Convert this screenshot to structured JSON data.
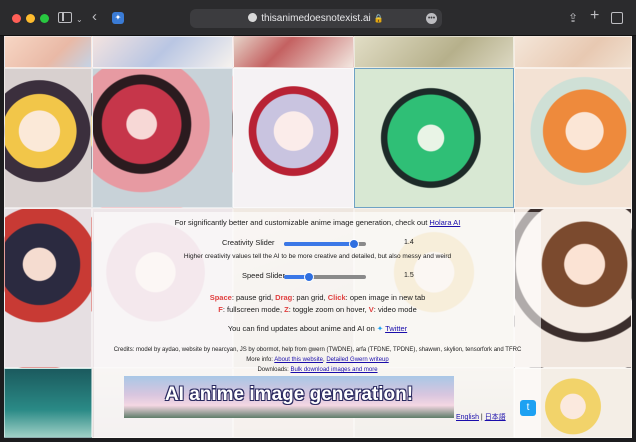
{
  "browser": {
    "url": "thisanimedoesnotexist.ai",
    "back_glyph": "‹",
    "chevron_glyph": "⌄",
    "share_glyph": "⇪",
    "new_tab_glyph": "+",
    "more_glyph": "•••",
    "lock_glyph": "🔒"
  },
  "promo": {
    "text": "For significantly better and customizable anime image generation, check out ",
    "link": "Holara AI"
  },
  "creativity": {
    "label": "Creativity Slider",
    "value": "1.4",
    "fraction": 0.85,
    "description": "Higher creativity values tell the AI to be more creative and detailed, but also messy and weird"
  },
  "speed": {
    "label": "Speed Slider",
    "value": "1.5",
    "fraction": 0.3
  },
  "shortcuts": {
    "line1": [
      {
        "key": "Space",
        "action": ": pause grid, "
      },
      {
        "key": "Drag",
        "action": ": pan grid, "
      },
      {
        "key": "Click",
        "action": ": open image in new tab"
      }
    ],
    "line2": [
      {
        "key": "F",
        "action": ": fullscreen mode, "
      },
      {
        "key": "Z",
        "action": ": toggle zoom on hover, "
      },
      {
        "key": "V",
        "action": ": video mode"
      }
    ]
  },
  "updates": {
    "text": "You can find updates about anime and AI on ",
    "link": "Twitter"
  },
  "credits": {
    "line1": "Credits: model by aydao, website by nearcyan, JS by obormot, help from gwern (TWDNE), arfa (TFDNE, TPDNE), shawwn, skylion, tensorfork and TFRC",
    "line2_label": "More info: ",
    "line2_links": [
      "About this website",
      "Detailed Gwern writeup"
    ],
    "line3_label": "Downloads: ",
    "line3_link": "Bulk download images and more"
  },
  "banner": {
    "text": "AI anime image generation!"
  },
  "language": {
    "english": "English",
    "separator": " | ",
    "japanese": "日本語"
  },
  "colors": {
    "accent": "#3b78e7",
    "key_red": "#e04040",
    "link": "#1a0dab",
    "twitter": "#1da1f2"
  }
}
